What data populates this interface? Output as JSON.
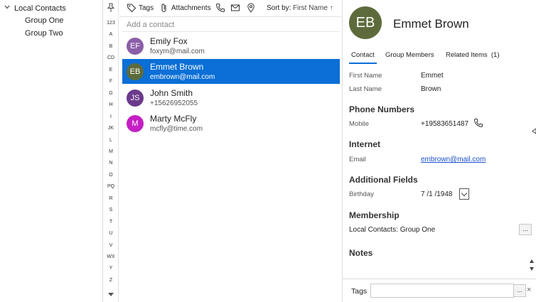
{
  "tree": {
    "root": "Local Contacts",
    "groups": [
      "Group One",
      "Group Two"
    ]
  },
  "alphabet": [
    "123",
    "A",
    "B",
    "CD",
    "E",
    "F",
    "G",
    "H",
    "I",
    "JK",
    "L",
    "M",
    "N",
    "O",
    "PQ",
    "R",
    "S",
    "T",
    "U",
    "V",
    "WX",
    "Y",
    "Z"
  ],
  "toolbar": {
    "tags_label": "Tags",
    "attachments_label": "Attachments",
    "sort_label": "Sort by:",
    "sort_value": "First Name ↑"
  },
  "list": {
    "add_placeholder": "Add a contact",
    "contacts": [
      {
        "initials": "EF",
        "name": "Emily Fox",
        "sub": "foxym@mail.com",
        "color": "#8b5ea8"
      },
      {
        "initials": "EB",
        "name": "Emmet Brown",
        "sub": "embrown@mail.com",
        "color": "#5d6b3c"
      },
      {
        "initials": "JS",
        "name": "John Smith",
        "sub": "+15626952055",
        "color": "#6b3a8c"
      },
      {
        "initials": "M",
        "name": "Marty McFly",
        "sub": "mcfly@time.com",
        "color": "#c41fc4"
      }
    ]
  },
  "detail": {
    "initials": "EB",
    "name": "Emmet Brown",
    "tabs": [
      "Contact",
      "Group Members",
      "Related Items  (1)"
    ],
    "first_name_label": "First Name",
    "first_name": "Emmet",
    "last_name_label": "Last Name",
    "last_name": "Brown",
    "phone_section": "Phone Numbers",
    "mobile_label": "Mobile",
    "mobile": "+19583651487",
    "internet_section": "Internet",
    "email_label": "Email",
    "email": "embrown@mail.com",
    "additional_section": "Additional Fields",
    "birthday_label": "Birthday",
    "birthday": "7 /1 /1948",
    "membership_section": "Membership",
    "membership": "Local Contacts: Group One",
    "notes_section": "Notes",
    "tags_label": "Tags",
    "ellipsis": "...",
    "clear": "×"
  },
  "colors": {
    "accent": "#0a6fd6",
    "link": "#1a4fd0"
  }
}
